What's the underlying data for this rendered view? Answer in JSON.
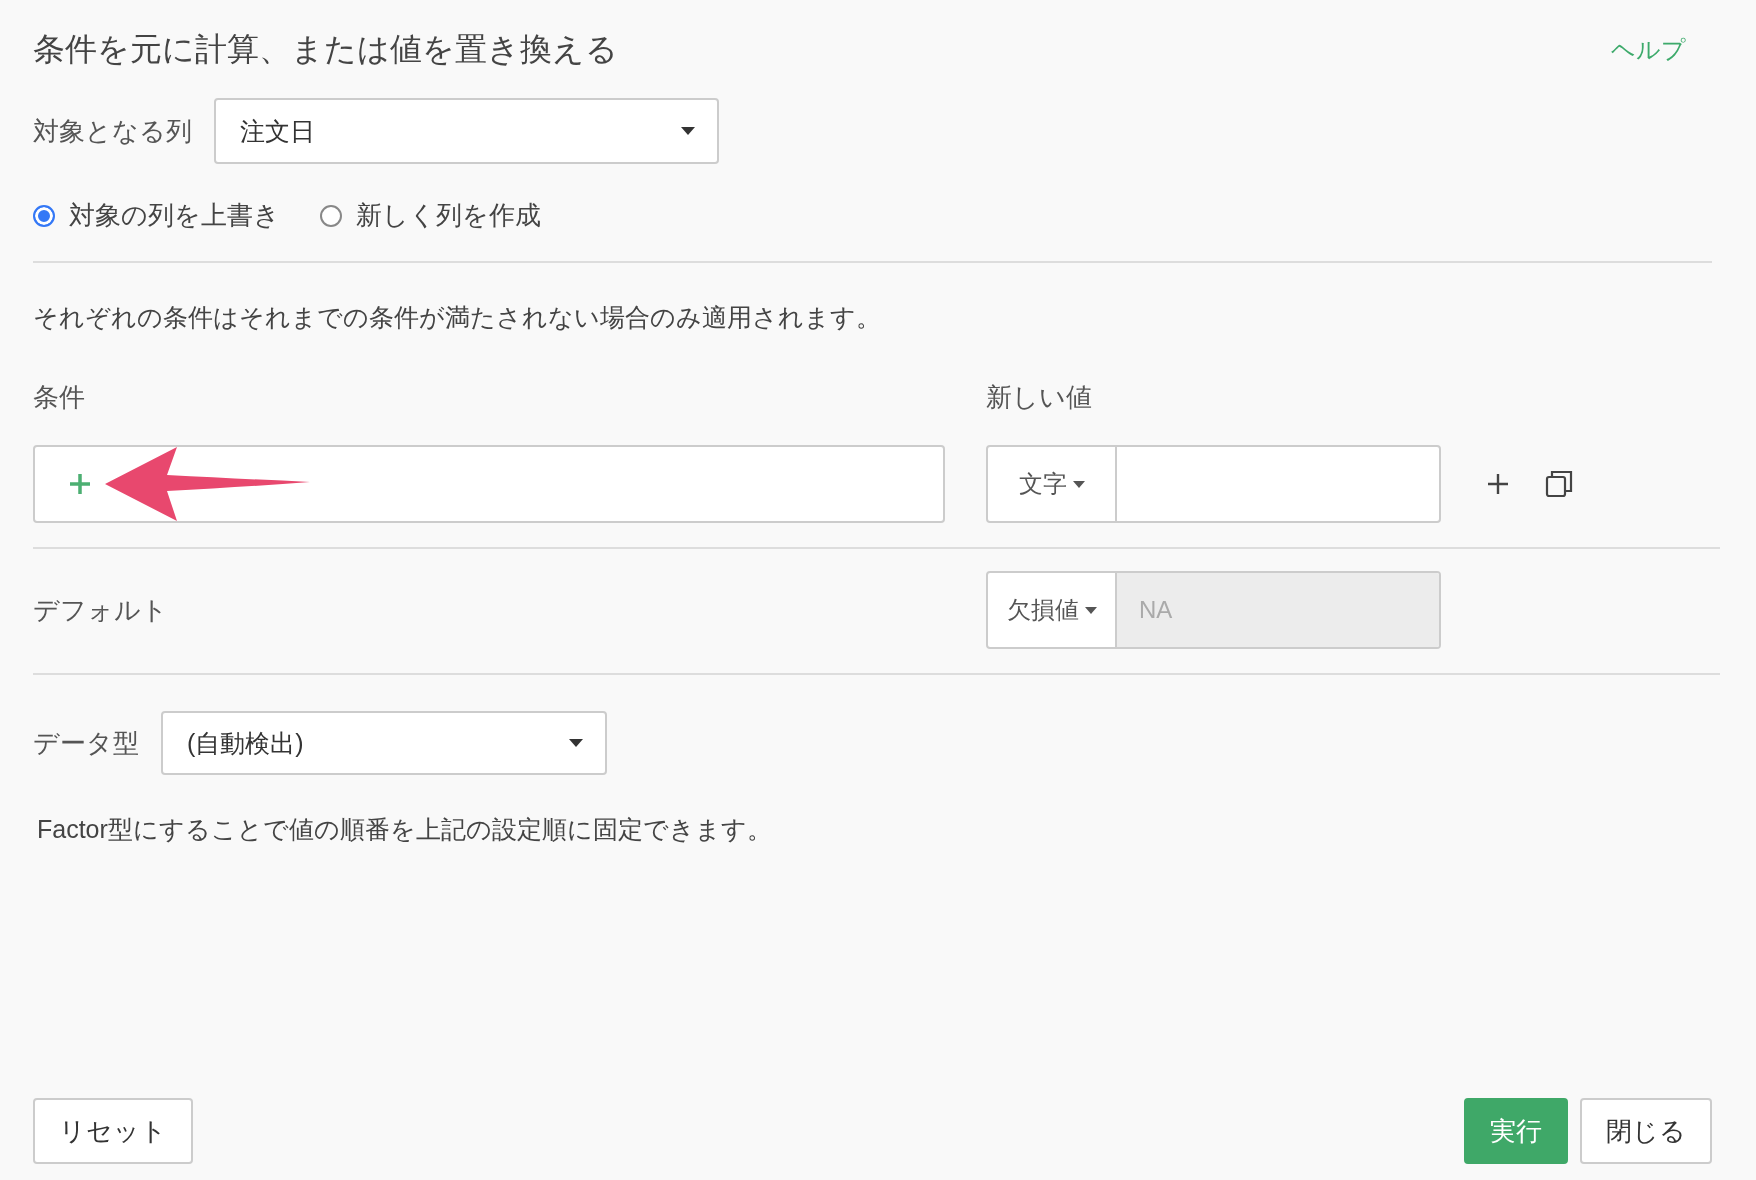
{
  "title": "条件を元に計算、または値を置き換える",
  "help_link": "ヘルプ",
  "target_column": {
    "label": "対象となる列",
    "value": "注文日"
  },
  "output_options": [
    {
      "label": "対象の列を上書き",
      "selected": true
    },
    {
      "label": "新しく列を作成",
      "selected": false
    }
  ],
  "description": "それぞれの条件はそれまでの条件が満たされない場合のみ適用されます。",
  "conditions": {
    "condition_header": "条件",
    "new_value_header": "新しい値",
    "rows": [
      {
        "value_type": "文字"
      }
    ]
  },
  "default": {
    "label": "デフォルト",
    "value_type": "欠損値",
    "value": "NA",
    "disabled": true
  },
  "data_type": {
    "label": "データ型",
    "value": "(自動検出)",
    "note": "Factor型にすることで値の順番を上記の設定順に固定できます。"
  },
  "buttons": {
    "reset": "リセット",
    "run": "実行",
    "close": "閉じる"
  }
}
